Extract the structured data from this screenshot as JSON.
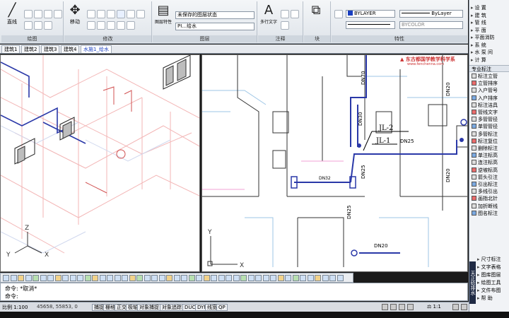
{
  "ribbon": {
    "panels": [
      {
        "title": "绘图",
        "big_label": "直线"
      },
      {
        "title": "修改",
        "big_label": "移动"
      },
      {
        "title": "图层",
        "big_label": "图层特性",
        "layer_state": "未保存的图层状态",
        "layer_name": "PI...给水"
      },
      {
        "title": "注释",
        "big_label": "多行文字",
        "big_glyph": "A"
      },
      {
        "title": "块",
        "big_label": "插入"
      },
      {
        "title": "特性",
        "color": "BYLAYER",
        "linetype": "ByLayer",
        "lineweight": "BYCOLOR"
      }
    ]
  },
  "doc_tabs": [
    {
      "label": "建筑1"
    },
    {
      "label": "建筑2"
    },
    {
      "label": "建筑3"
    },
    {
      "label": "建筑4"
    },
    {
      "label": "水施1_给水",
      "active": true
    }
  ],
  "drawing": {
    "watermark": "东古都国学教学科学系",
    "watermark_sub": "www.fenchenna.com",
    "labels": {
      "jl2": "JL-2",
      "jl1": "JL-1",
      "dn25_a": "DN25",
      "dn25_b": "DN25",
      "dn25_c": "DN25",
      "dn20_a": "DN20",
      "dn20_b": "DN20",
      "dn20_c": "DN20",
      "dn70": "DN70",
      "dn32": "DN32",
      "dn30": "DN30"
    },
    "axis_x": "X",
    "axis_y": "Y",
    "axis_z": "Z"
  },
  "command": {
    "line1": "命令: *取消*",
    "line2": "命令:"
  },
  "status": {
    "scale": "比例 1:100",
    "coords": "45658, 55853, 0",
    "buttons": [
      "捕捉",
      "栅格",
      "正交",
      "极轴",
      "对象捕捉",
      "对象追踪",
      "DUCS",
      "DYN",
      "线宽",
      "QP"
    ],
    "zoom": "1:1"
  },
  "side_menu": {
    "top_items": [
      "设 置",
      "建 筑",
      "管 线",
      "平 面",
      "平面消防",
      "系 统",
      "水 泵 间",
      "计 算"
    ],
    "category": "专业标注",
    "items": [
      "标注立管",
      "立管排序",
      "入户管号",
      "入户排序",
      "标注洁具",
      "管线文字",
      "多管管径",
      "单管管径",
      "多管标注",
      "标注复位",
      "删除标注",
      "单注标高",
      "连注标高",
      "逆坡标高",
      "箭头引注",
      "引出标注",
      "多线引出",
      "画指北针",
      "加折断线",
      "图名标注"
    ],
    "bottom_items": [
      "尺寸标注",
      "文字表格",
      "图库图层",
      "绘图工具",
      "文件布图",
      "帮 助"
    ],
    "vertical_label": "天正给排水"
  }
}
